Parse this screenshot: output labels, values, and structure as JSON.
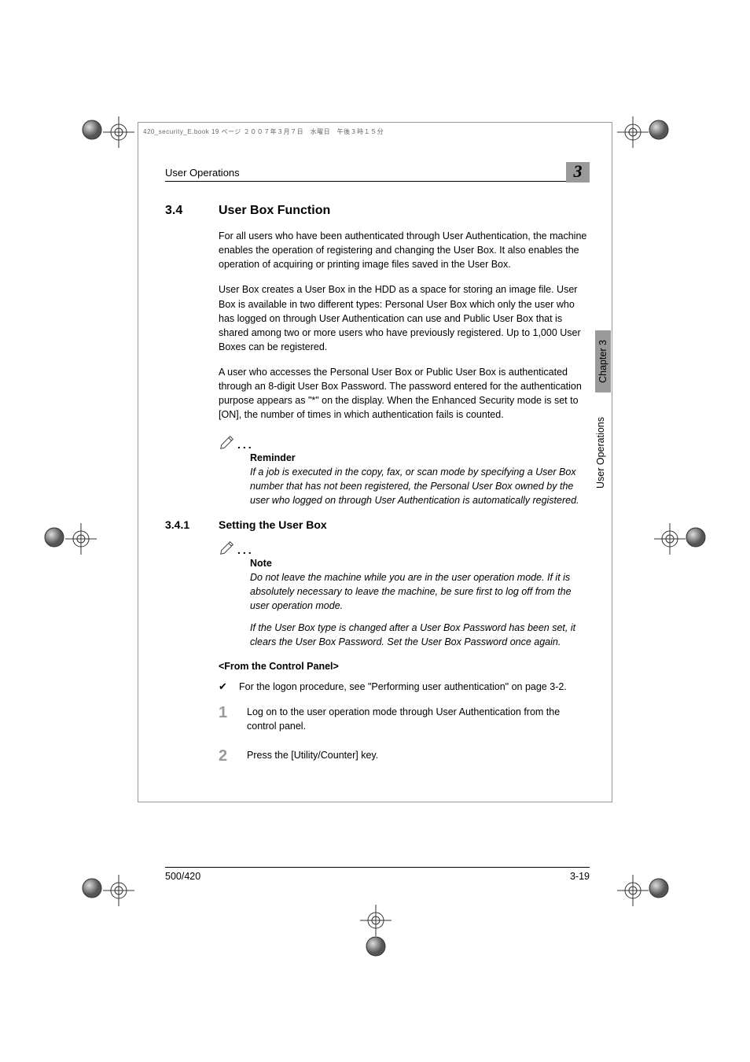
{
  "header_strip": "420_security_E.book  19 ページ  ２００７年３月７日　水曜日　午後３時１５分",
  "running_head": {
    "title": "User Operations",
    "chapter_num": "3"
  },
  "side_tabs": {
    "chapter": "Chapter 3",
    "section": "User Operations"
  },
  "section": {
    "num": "3.4",
    "title": "User Box Function",
    "p1": "For all users who have been authenticated through User Authentication, the machine enables the operation of registering and changing the User Box. It also enables the operation of acquiring or printing image files saved in the User Box.",
    "p2": "User Box creates a User Box in the HDD as a space for storing an image file. User Box is available in two different types: Personal User Box which only the user who has logged on through User Authentication can use and Public User Box that is shared among two or more users who have previously registered. Up to 1,000 User Boxes can be registered.",
    "p3": "A user who accesses the Personal User Box or Public User Box is authenticated through an 8-digit User Box Password. The password entered for the authentication purpose appears as \"*\" on the display. When the Enhanced Security mode is set to [ON], the number of times in which authentication fails is counted."
  },
  "reminder": {
    "heading": "Reminder",
    "text": "If a job is executed in the copy, fax, or scan mode by specifying a User Box number that has not been registered, the Personal User Box owned by the user who logged on through User Authentication is automatically registered."
  },
  "subsection": {
    "num": "3.4.1",
    "title": "Setting the User Box"
  },
  "note": {
    "heading": "Note",
    "text1": "Do not leave the machine while you are in the user operation mode. If it is absolutely necessary to leave the machine, be sure first to log off from the user operation mode.",
    "text2": "If the User Box type is changed after a User Box Password has been set, it clears the User Box Password. Set the User Box Password once again."
  },
  "from_panel": "<From the Control Panel>",
  "check_item": "For the logon procedure, see \"Performing user authentication\" on page 3-2.",
  "steps": {
    "s1": {
      "n": "1",
      "t": "Log on to the user operation mode through User Authentication from the control panel."
    },
    "s2": {
      "n": "2",
      "t": "Press the [Utility/Counter] key."
    }
  },
  "footer": {
    "left": "500/420",
    "right": "3-19"
  }
}
